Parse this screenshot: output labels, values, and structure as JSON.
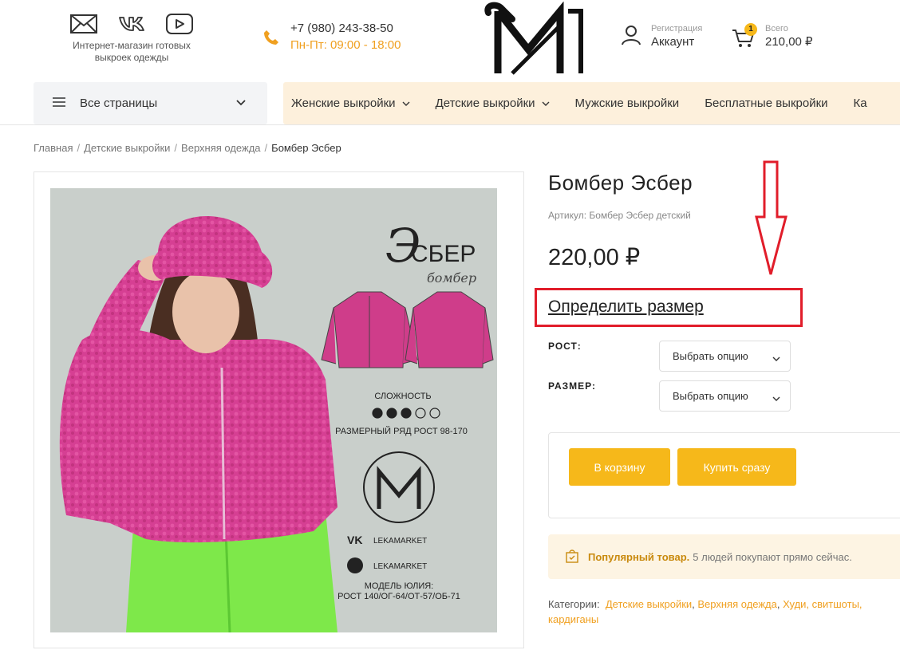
{
  "header": {
    "tagline": "Интернет-магазин готовых выкроек одежды",
    "social": [
      "mail-icon",
      "vk-icon",
      "youtube-icon"
    ],
    "phone": "+7 (980) 243-38-50",
    "hours": "Пн-Пт: 09:00 - 18:00",
    "account": {
      "small": "Регистрация",
      "label": "Аккаунт"
    },
    "cart": {
      "count": "1",
      "small": "Всего",
      "total": "210,00 ₽"
    }
  },
  "nav": {
    "all_pages": "Все страницы",
    "menu": [
      {
        "label": "Женские выкройки",
        "dropdown": true
      },
      {
        "label": "Детские выкройки",
        "dropdown": true
      },
      {
        "label": "Мужские выкройки",
        "dropdown": false
      },
      {
        "label": "Бесплатные выкройки",
        "dropdown": false
      },
      {
        "label": "Ка",
        "dropdown": false
      }
    ]
  },
  "breadcrumb": [
    "Главная",
    "Детские выкройки",
    "Верхняя одежда",
    "Бомбер Эсбер"
  ],
  "product": {
    "title": "Бомбер Эсбер",
    "sku_label": "Артикул:",
    "sku": "Бомбер Эсбер детский",
    "price": "220,00 ₽",
    "size_link": "Определить размер",
    "options": [
      {
        "label": "РОСТ:",
        "value": "Выбрать опцию"
      },
      {
        "label": "РАЗМЕР:",
        "value": "Выбрать опцию"
      }
    ],
    "add_to_cart": "В корзину",
    "buy_now": "Купить сразу",
    "popular_strong": "Популярный товар.",
    "popular_text": "5 людей покупают прямо сейчас.",
    "categories_label": "Категории:",
    "categories": [
      "Детские выкройки",
      "Верхняя одежда",
      "Худи, свитшоты,",
      "кардиганы"
    ]
  },
  "image": {
    "brand_script": "Э",
    "brand_title": "СБЕР",
    "brand_sub": "бомбер",
    "complexity_label": "СЛОЖНОСТЬ",
    "complexity_level": 3,
    "complexity_max": 5,
    "size_range": "РАЗМЕРНЫЙ РЯД РОСТ 98-170",
    "social_1": "LEKAMARKET",
    "social_2": "LEKAMARKET",
    "model_1": "МОДЕЛЬ ЮЛИЯ:",
    "model_2": "РОСТ 140/ОГ-64/ОТ-57/ОБ-71"
  },
  "colors": {
    "accent": "#f6b81a",
    "menu_bg": "#fdf0dc",
    "highlight": "#e11d2a",
    "garment": "#d63f93",
    "pants": "#7ee84a"
  }
}
